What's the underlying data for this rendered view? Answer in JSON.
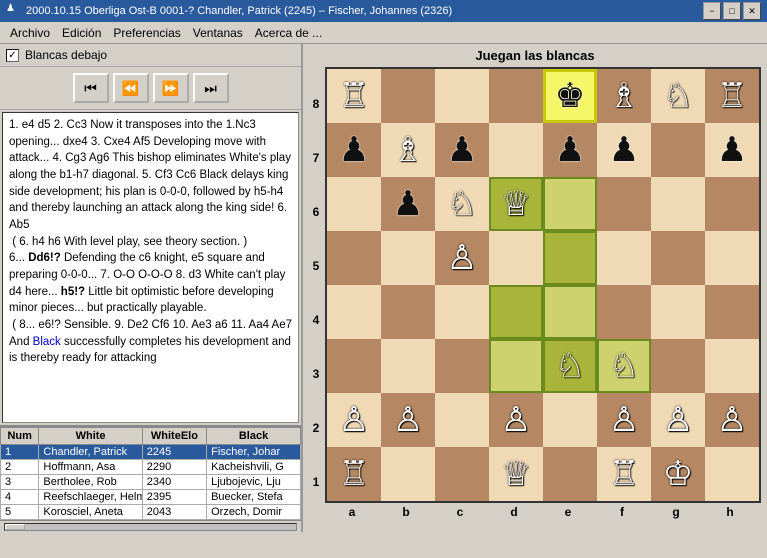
{
  "titlebar": {
    "text": "2000.10.15 Oberliga Ost-B 0001-? Chandler, Patrick (2245) – Fischer, Johannes (2326)",
    "icon": "♟",
    "btn_min": "−",
    "btn_max": "□",
    "btn_close": "✕"
  },
  "menu": {
    "items": [
      "Archivo",
      "Edición",
      "Preferencias",
      "Ventanas",
      "Acerca de ..."
    ]
  },
  "left": {
    "white_below_label": "Blancas debajo",
    "controls": {
      "first": "⏮",
      "prev": "⏪",
      "next": "⏩",
      "last": "⏭"
    },
    "notation": "1. e4 d5 2. Cc3 Now it transposes into the 1.Nc3 opening... dxe4 3. Cxe4 Af5 Developing move with attack... 4. Cg3 Ag6 This bishop eliminates White's play along the b1-h7 diagonal. 5. Cf3 Cc6 Black delays king side development; his plan is 0-0-0, followed by h5-h4 and thereby launching an attack along the king side! 6. Ab5\n ( 6. h4 h6 With level play, see theory section. )\n6... Dd6!? Defending the c6 knight, e5 square and preparing 0-0-0... 7. O-O O-O-O 8. d3 White can't play d4 here... h5!? Little bit optimistic before developing minor pieces... but practically playable.\n ( 8... e6!? Sensible. 9. De2 Cf6 10. Ae3 a6 11. Aa4 Ae7 And Black successfully completes his development and is thereby ready for attacking"
  },
  "table": {
    "headers": [
      "Num",
      "White",
      "WhiteElo",
      "Black"
    ],
    "rows": [
      {
        "num": "1",
        "white": "Chandler, Patrick",
        "elo": "2245",
        "black": "Fischer, Johar",
        "selected": true
      },
      {
        "num": "2",
        "white": "Hoffmann, Asa",
        "elo": "2290",
        "black": "Kacheishvili, G",
        "selected": false
      },
      {
        "num": "3",
        "white": "Bertholee, Rob",
        "elo": "2340",
        "black": "Ljubojevic, Lju",
        "selected": false
      },
      {
        "num": "4",
        "white": "Reefschlaeger, Helmut",
        "elo": "2395",
        "black": "Buecker, Stefa",
        "selected": false
      },
      {
        "num": "5",
        "white": "Korosciel, Aneta",
        "elo": "2043",
        "black": "Orzech, Domir",
        "selected": false
      }
    ]
  },
  "board": {
    "title": "Juegan las blancas",
    "files": [
      "a",
      "b",
      "c",
      "d",
      "e",
      "f",
      "g",
      "h"
    ],
    "ranks": [
      "8",
      "7",
      "6",
      "5",
      "4",
      "3",
      "2",
      "1"
    ],
    "squares": [
      [
        "R",
        "",
        "",
        "",
        "k",
        "B",
        "N",
        "R"
      ],
      [
        "p",
        "B",
        "p",
        "",
        "p",
        "p",
        "",
        "p"
      ],
      [
        "",
        "p",
        "N",
        "Q",
        "",
        "",
        "",
        ""
      ],
      [
        "",
        "",
        "P",
        "",
        "",
        "",
        "",
        ""
      ],
      [
        "",
        "",
        "",
        "",
        "",
        "",
        "",
        ""
      ],
      [
        "",
        "",
        "",
        "",
        "N",
        "N",
        "",
        ""
      ],
      [
        "P",
        "P",
        "",
        "P",
        "",
        "P",
        "P",
        "P"
      ],
      [
        "R",
        "",
        "",
        "Q",
        "",
        "R",
        "K",
        ""
      ]
    ],
    "piece_map": {
      "K": "♔",
      "Q": "♕",
      "R": "♖",
      "B": "♗",
      "N": "♘",
      "P": "♙",
      "k": "♚",
      "q": "♛",
      "r": "♜",
      "b": "♝",
      "n": "♞",
      "p": "♟"
    },
    "highlights": {
      "yellow": [
        "e8"
      ],
      "green": [
        "e6",
        "d6",
        "e5",
        "d4",
        "e4",
        "d3",
        "e3",
        "f3"
      ]
    }
  },
  "black_text": "Black"
}
